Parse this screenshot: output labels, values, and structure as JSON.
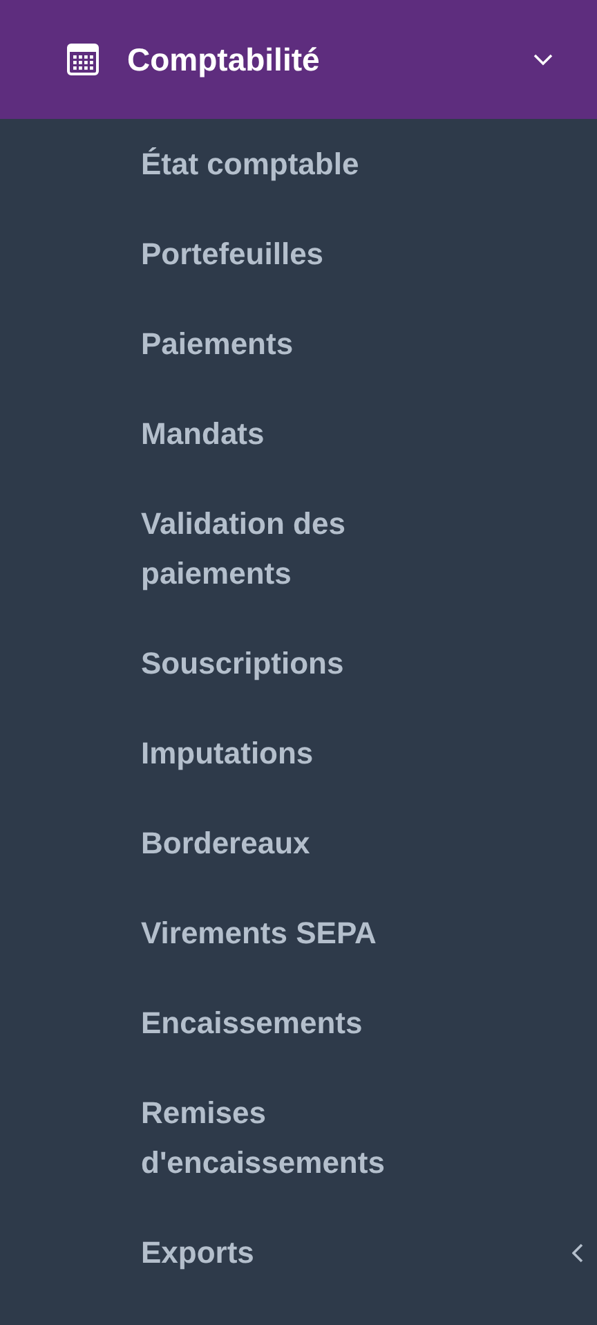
{
  "section": {
    "title": "Comptabilité",
    "expanded": true
  },
  "items": [
    {
      "label": "État comptable"
    },
    {
      "label": "Portefeuilles"
    },
    {
      "label": "Paiements"
    },
    {
      "label": "Mandats"
    },
    {
      "label": "Validation des paiements"
    },
    {
      "label": "Souscriptions"
    },
    {
      "label": "Imputations"
    },
    {
      "label": "Bordereaux"
    },
    {
      "label": "Virements SEPA"
    },
    {
      "label": "Encaissements"
    },
    {
      "label": "Remises d'encaissements"
    },
    {
      "label": "Exports",
      "kind": "submenu",
      "expanded": false
    }
  ]
}
